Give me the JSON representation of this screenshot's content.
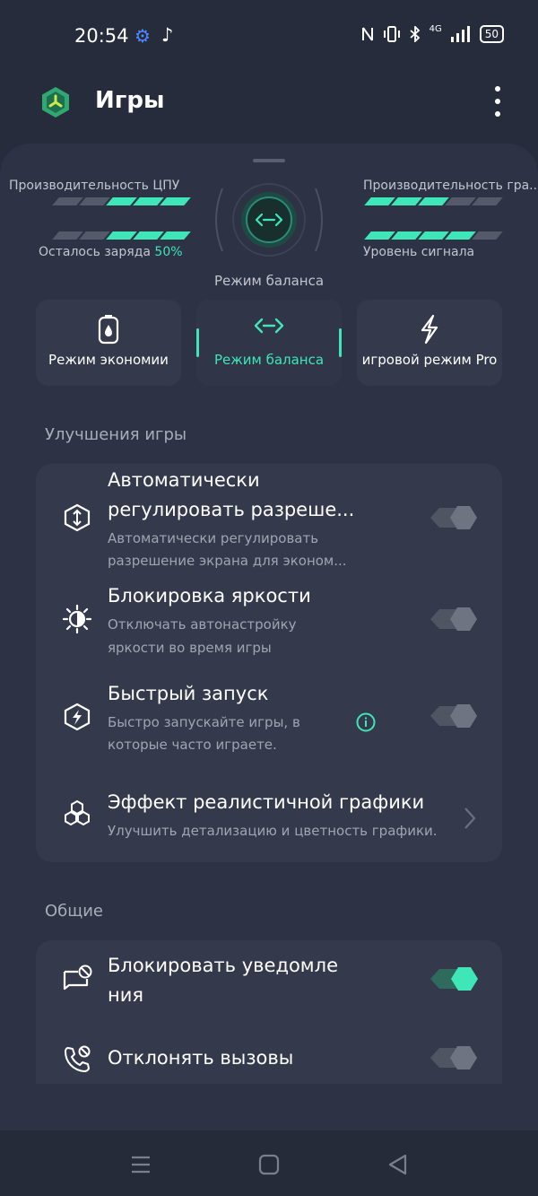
{
  "status_bar": {
    "time": "20:54",
    "network": "4G",
    "battery": "50"
  },
  "header": {
    "title": "Игры"
  },
  "performance": {
    "cpu_label": "Производительность ЦПУ",
    "gpu_label": "Производительность гра...",
    "battery_label": "Осталось заряда",
    "battery_value": "50%",
    "signal_label": "Уровень сигнала",
    "current_mode": "Режим баланса"
  },
  "modes": [
    {
      "label": "Режим экономии",
      "icon": "battery-drop-icon",
      "active": false
    },
    {
      "label": "Режим баланса",
      "icon": "balance-arrows-icon",
      "active": true
    },
    {
      "label": "игровой режим Pro",
      "icon": "lightning-icon",
      "active": false
    }
  ],
  "game_section": {
    "title": "Улучшения игры",
    "items": [
      {
        "title_line1": "Автоматически",
        "title_line2": "регулировать разреше...",
        "sub_line1": "Автоматически регулировать",
        "sub_line2": "разрешение экрана для эконом...",
        "icon": "resolution-icon",
        "toggle": "off"
      },
      {
        "title": "Блокировка яркости",
        "sub_line1": "Отключать автонастройку",
        "sub_line2": "яркости во время игры",
        "icon": "brightness-icon",
        "toggle": "off"
      },
      {
        "title": "Быстрый запуск",
        "sub_line1": "Быстро запускайте игры, в",
        "sub_line2": "которые часто играете.",
        "icon": "quick-launch-icon",
        "toggle": "off"
      },
      {
        "title": "Эффект реалистичной графики",
        "sub": "Улучшить детализацию и цветность графики.",
        "icon": "graphics-hexagons-icon"
      }
    ]
  },
  "general_section": {
    "title": "Общие",
    "items": [
      {
        "title_line1": "Блокировать уведомле",
        "title_line2": "ния",
        "icon": "block-notifications-icon",
        "toggle": "on"
      },
      {
        "title": "Отклонять вызовы",
        "icon": "reject-calls-icon",
        "toggle": "off"
      }
    ]
  },
  "colors": {
    "accent": "#3ee6b8",
    "background": "#272c3d",
    "card": "#343a4c"
  }
}
